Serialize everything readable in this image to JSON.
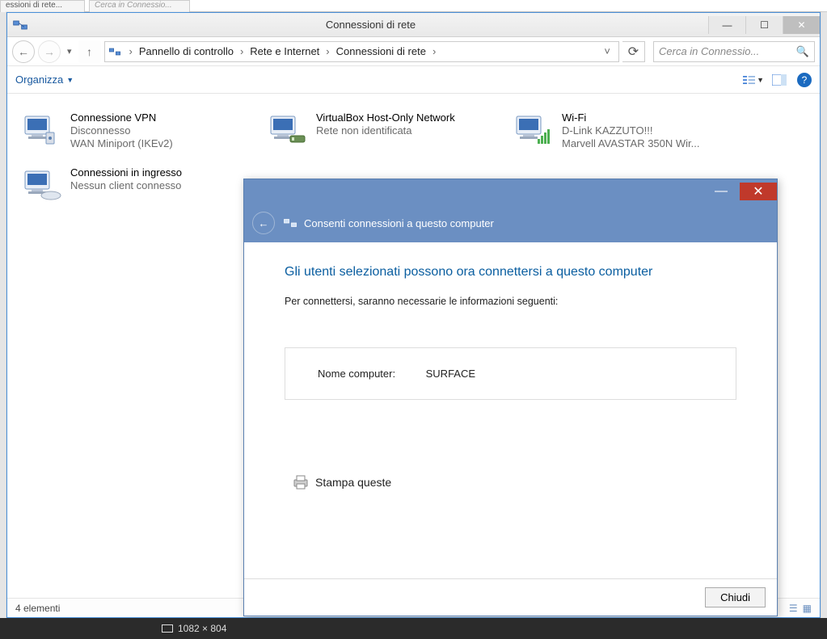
{
  "bg_tabs": {
    "a": "essioni di rete...",
    "b": "Cerca in Connessio..."
  },
  "window": {
    "title": "Connessioni di rete",
    "breadcrumb": [
      "Pannello di controllo",
      "Rete e Internet",
      "Connessioni di rete"
    ],
    "search_placeholder": "Cerca in Connessio...",
    "organize": "Organizza",
    "status": "4 elementi"
  },
  "connections": [
    {
      "name": "Connessione VPN",
      "status": "Disconnesso",
      "device": "WAN Miniport (IKEv2)",
      "icon": "vpn"
    },
    {
      "name": "VirtualBox Host-Only Network",
      "status": "Rete non identificata",
      "device": "",
      "icon": "ethernet"
    },
    {
      "name": "Wi-Fi",
      "status": "D-Link KAZZUTO!!!",
      "device": "Marvell AVASTAR 350N Wir...",
      "icon": "wifi"
    },
    {
      "name": "Connessioni in ingresso",
      "status": "Nessun client connesso",
      "device": "",
      "icon": "incoming"
    }
  ],
  "dialog": {
    "header": "Consenti connessioni a questo computer",
    "heading": "Gli utenti selezionati possono ora connettersi a questo computer",
    "subtext": "Per connettersi, saranno necessarie le informazioni seguenti:",
    "info_label": "Nome computer:",
    "info_value": "SURFACE",
    "print": "Stampa queste",
    "close_btn": "Chiudi"
  },
  "os_strip": {
    "dims": "1082 × 804"
  }
}
